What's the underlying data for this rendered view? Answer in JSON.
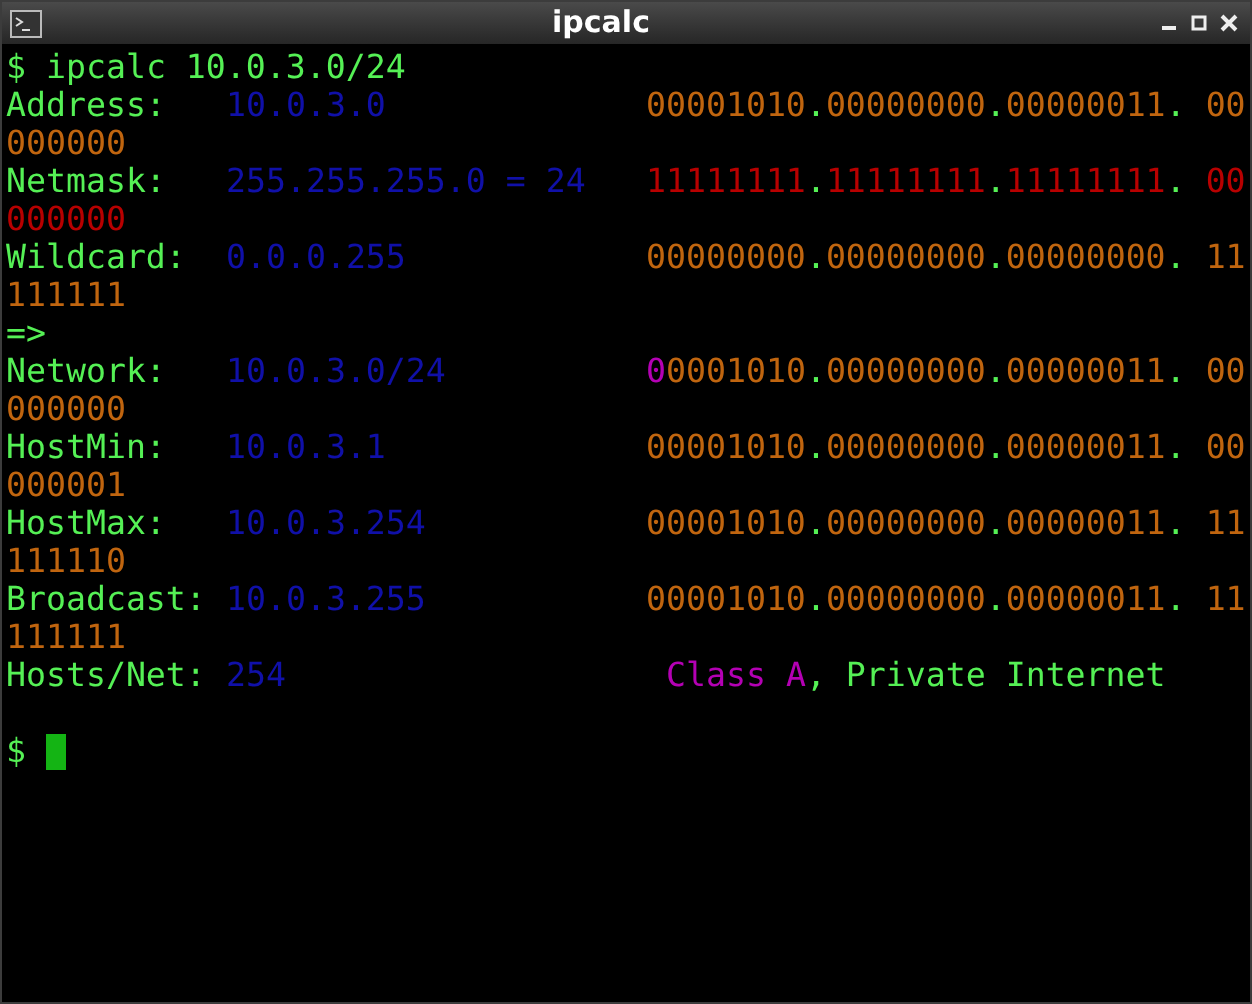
{
  "window": {
    "title": "ipcalc"
  },
  "terminal": {
    "command": {
      "prompt": "$",
      "text": "ipcalc 10.0.3.0/24"
    },
    "rows": [
      {
        "label": "Address:",
        "value": "10.0.3.0",
        "bits": [
          {
            "kind": "bits",
            "text": "00001010",
            "sep": "."
          },
          {
            "kind": "bits",
            "text": "00000000",
            "sep": "."
          },
          {
            "kind": "bits",
            "text": "00000011",
            "sep": "."
          },
          {
            "kind": "bits",
            "text": "00",
            "spaced": true
          }
        ],
        "wrap": [
          {
            "kind": "bits",
            "text": "000000"
          }
        ]
      },
      {
        "label": "Netmask:",
        "value": "255.255.255.0 = 24",
        "bits": [
          {
            "kind": "mask",
            "text": "11111111",
            "sep": "."
          },
          {
            "kind": "mask",
            "text": "11111111",
            "sep": "."
          },
          {
            "kind": "mask",
            "text": "11111111",
            "sep": "."
          },
          {
            "kind": "mask",
            "text": "00",
            "spaced": true
          }
        ],
        "wrap": [
          {
            "kind": "mask",
            "text": "000000"
          }
        ]
      },
      {
        "label": "Wildcard:",
        "value": "0.0.0.255",
        "bits": [
          {
            "kind": "bits",
            "text": "00000000",
            "sep": "."
          },
          {
            "kind": "bits",
            "text": "00000000",
            "sep": "."
          },
          {
            "kind": "bits",
            "text": "00000000",
            "sep": "."
          },
          {
            "kind": "bits",
            "text": "11",
            "spaced": true
          }
        ],
        "wrap": [
          {
            "kind": "bits",
            "text": "111111"
          }
        ]
      },
      {
        "label": "=>"
      },
      {
        "label": "Network:",
        "value": "10.0.3.0/24",
        "bits": [
          {
            "kind": "class",
            "text": "0"
          },
          {
            "kind": "bits",
            "text": "0001010",
            "sep": "."
          },
          {
            "kind": "bits",
            "text": "00000000",
            "sep": "."
          },
          {
            "kind": "bits",
            "text": "00000011",
            "sep": "."
          },
          {
            "kind": "bits",
            "text": "00",
            "spaced": true
          }
        ],
        "wrap": [
          {
            "kind": "bits",
            "text": "000000"
          }
        ]
      },
      {
        "label": "HostMin:",
        "value": "10.0.3.1",
        "bits": [
          {
            "kind": "bits",
            "text": "00001010",
            "sep": "."
          },
          {
            "kind": "bits",
            "text": "00000000",
            "sep": "."
          },
          {
            "kind": "bits",
            "text": "00000011",
            "sep": "."
          },
          {
            "kind": "bits",
            "text": "00",
            "spaced": true
          }
        ],
        "wrap": [
          {
            "kind": "bits",
            "text": "000001"
          }
        ]
      },
      {
        "label": "HostMax:",
        "value": "10.0.3.254",
        "bits": [
          {
            "kind": "bits",
            "text": "00001010",
            "sep": "."
          },
          {
            "kind": "bits",
            "text": "00000000",
            "sep": "."
          },
          {
            "kind": "bits",
            "text": "00000011",
            "sep": "."
          },
          {
            "kind": "bits",
            "text": "11",
            "spaced": true
          }
        ],
        "wrap": [
          {
            "kind": "bits",
            "text": "111110"
          }
        ]
      },
      {
        "label": "Broadcast:",
        "value": "10.0.3.255",
        "bits": [
          {
            "kind": "bits",
            "text": "00001010",
            "sep": "."
          },
          {
            "kind": "bits",
            "text": "00000000",
            "sep": "."
          },
          {
            "kind": "bits",
            "text": "00000011",
            "sep": "."
          },
          {
            "kind": "bits",
            "text": "11",
            "spaced": true
          }
        ],
        "wrap": [
          {
            "kind": "bits",
            "text": "111111"
          }
        ]
      },
      {
        "label": "Hosts/Net:",
        "value": "254",
        "bits": [
          {
            "kind": "class",
            "text": "Class A",
            "spaced": true
          },
          {
            "kind": "note",
            "text": ", Private Internet"
          }
        ]
      }
    ],
    "prompt": "$"
  }
}
